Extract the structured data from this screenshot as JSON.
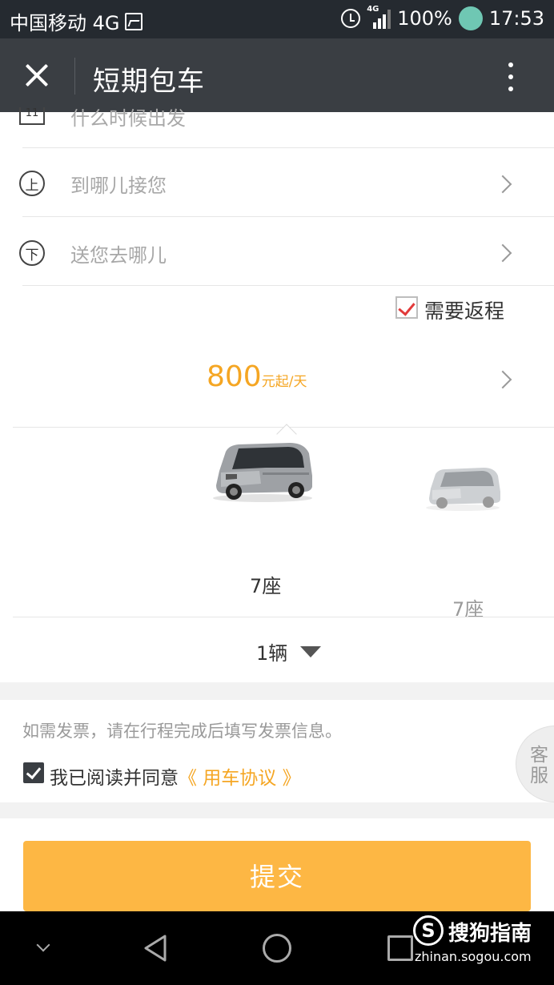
{
  "status_bar": {
    "carrier": "中国移动 4G",
    "network_tag": "4G",
    "battery": "100%",
    "time": "17:53"
  },
  "header": {
    "title": "短期包车"
  },
  "form": {
    "date_icon_text": "11",
    "date_placeholder": "什么时候出发",
    "pickup_icon_text": "上",
    "pickup_placeholder": "到哪儿接您",
    "dropoff_icon_text": "下",
    "dropoff_placeholder": "送您去哪儿",
    "return_trip_label": "需要返程",
    "return_trip_checked": true
  },
  "pricing": {
    "amount": "800",
    "unit": "元起/天"
  },
  "vehicles": [
    {
      "seats": "7座",
      "selected": true
    },
    {
      "seats": "7座",
      "selected": false
    }
  ],
  "quantity": {
    "value": "1辆"
  },
  "invoice_note": "如需发票，请在行程完成后填写发票信息。",
  "agreement": {
    "checked": true,
    "prefix": "我已阅读并同意",
    "link": "《 用车协议 》"
  },
  "customer_service": "客服",
  "submit_label": "提交",
  "watermark": {
    "logo": "S",
    "name": "搜狗指南",
    "url": "zhinan.sogou.com"
  },
  "colors": {
    "accent": "#f5a623",
    "submit": "#fdb744",
    "title_bar": "#3a3e43",
    "status_bar": "#252a30"
  }
}
